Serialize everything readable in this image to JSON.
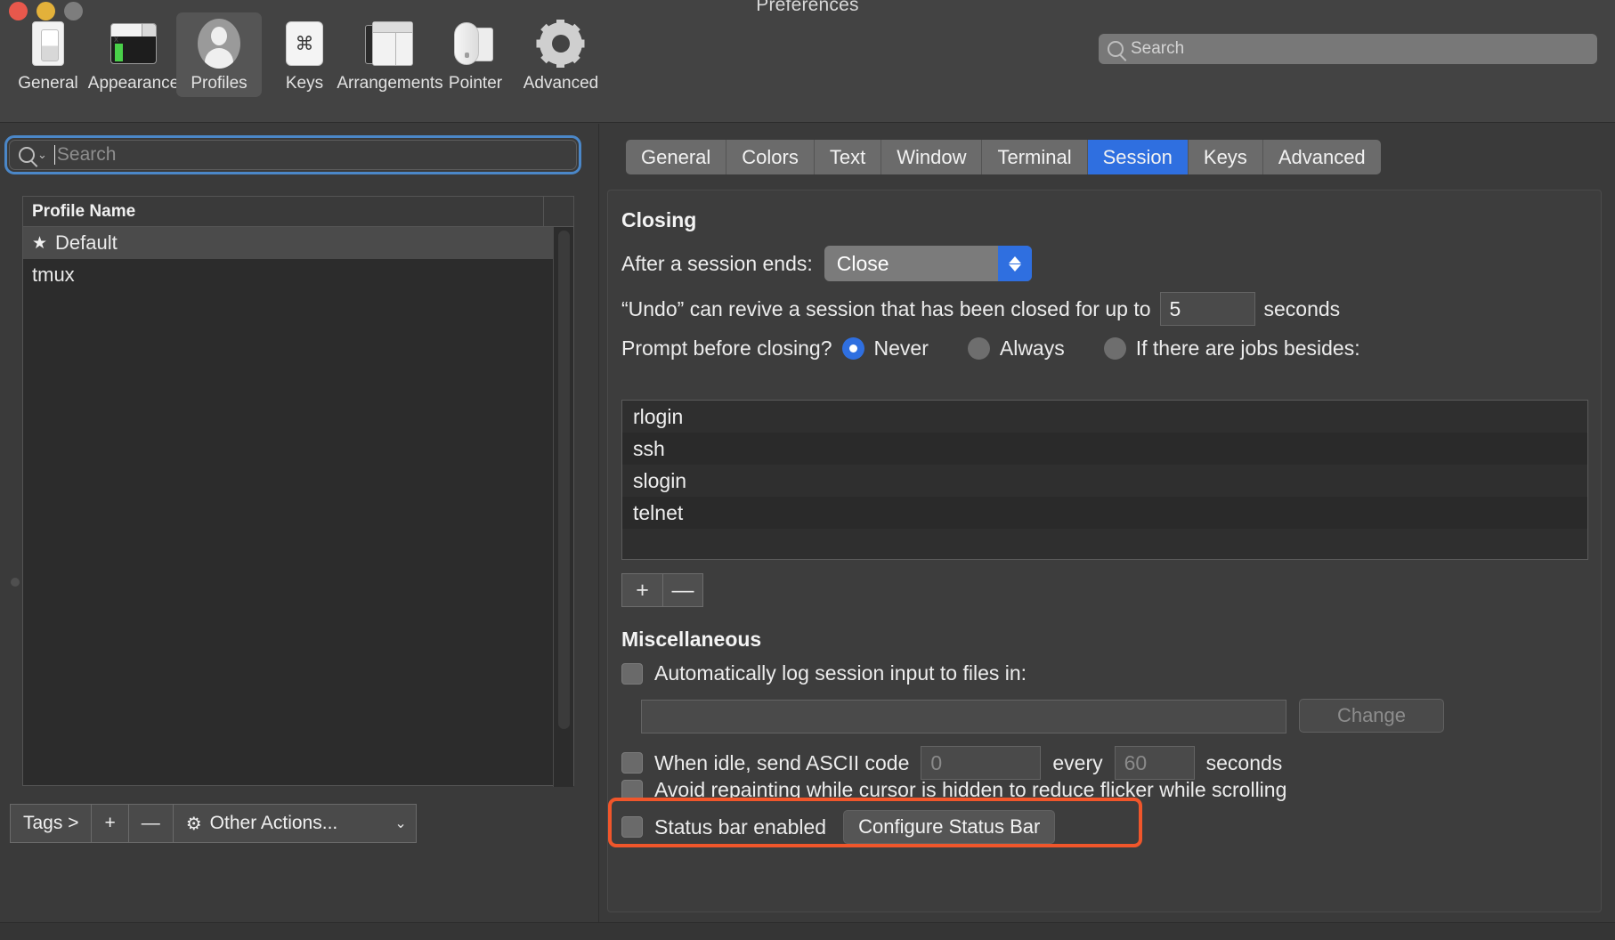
{
  "window": {
    "title": "Preferences",
    "traffic_lights": [
      "close",
      "minimize",
      "zoom"
    ]
  },
  "toolbar": {
    "items": [
      {
        "label": "General",
        "icon": "general-icon",
        "selected": false
      },
      {
        "label": "Appearance",
        "icon": "appearance-icon",
        "selected": false
      },
      {
        "label": "Profiles",
        "icon": "profiles-icon",
        "selected": true
      },
      {
        "label": "Keys",
        "icon": "keys-icon",
        "selected": false
      },
      {
        "label": "Arrangements",
        "icon": "arrangements-icon",
        "selected": false
      },
      {
        "label": "Pointer",
        "icon": "pointer-icon",
        "selected": false
      },
      {
        "label": "Advanced",
        "icon": "advanced-icon",
        "selected": false
      }
    ],
    "search": {
      "placeholder": "Search",
      "value": "",
      "icon": "search-icon"
    }
  },
  "sidebar": {
    "search": {
      "placeholder": "Search",
      "value": "",
      "icon": "search-icon",
      "focused": true
    },
    "table": {
      "column_header": "Profile Name",
      "rows": [
        {
          "name": "Default",
          "starred": true,
          "selected": true,
          "star_glyph": "★"
        },
        {
          "name": "tmux",
          "starred": false,
          "selected": false,
          "star_glyph": ""
        }
      ]
    },
    "bottom_toolbar": {
      "tags_label": "Tags >",
      "add_label": "+",
      "remove_label": "—",
      "other_actions_label": "Other Actions...",
      "other_actions_icon": "gear-icon",
      "chevron": "⌄"
    }
  },
  "right_pane": {
    "tabs": [
      {
        "label": "General",
        "active": false
      },
      {
        "label": "Colors",
        "active": false
      },
      {
        "label": "Text",
        "active": false
      },
      {
        "label": "Window",
        "active": false
      },
      {
        "label": "Terminal",
        "active": false
      },
      {
        "label": "Session",
        "active": true
      },
      {
        "label": "Keys",
        "active": false
      },
      {
        "label": "Advanced",
        "active": false
      }
    ],
    "closing": {
      "section_title": "Closing",
      "after_session_label": "After a session ends:",
      "after_session_value": "Close",
      "undo_prefix": "“Undo” can revive a session that has been closed for up to",
      "undo_value": "5",
      "undo_suffix": "seconds",
      "prompt_label": "Prompt before closing?",
      "prompt_options": [
        {
          "label": "Never",
          "selected": true
        },
        {
          "label": "Always",
          "selected": false
        },
        {
          "label": "If there are jobs besides:",
          "selected": false
        }
      ],
      "jobs": [
        "rlogin",
        "ssh",
        "slogin",
        "telnet"
      ],
      "add_label": "+",
      "remove_label": "—"
    },
    "miscellaneous": {
      "section_title": "Miscellaneous",
      "log_checkbox_label": "Automatically log session input to files in:",
      "log_checked": false,
      "log_path_value": "",
      "change_button_label": "Change",
      "change_enabled": false,
      "idle_checked": false,
      "idle_prefix": "When idle, send ASCII code",
      "idle_code_value": "0",
      "idle_middle": "every",
      "idle_seconds_value": "60",
      "idle_suffix": "seconds",
      "avoid_repaint_checked": false,
      "avoid_repaint_label": "Avoid repainting while cursor is hidden to reduce flicker while scrolling",
      "status_bar_checked": false,
      "status_bar_label": "Status bar enabled",
      "configure_status_bar_label": "Configure Status Bar",
      "highlight_color": "#f0562b"
    }
  },
  "colors": {
    "accent_blue": "#2f6fe0",
    "focus_ring": "#4b87c8",
    "highlight_orange": "#f0562b",
    "window_bg": "#3a3a3a",
    "toolbar_bg": "#434343"
  }
}
